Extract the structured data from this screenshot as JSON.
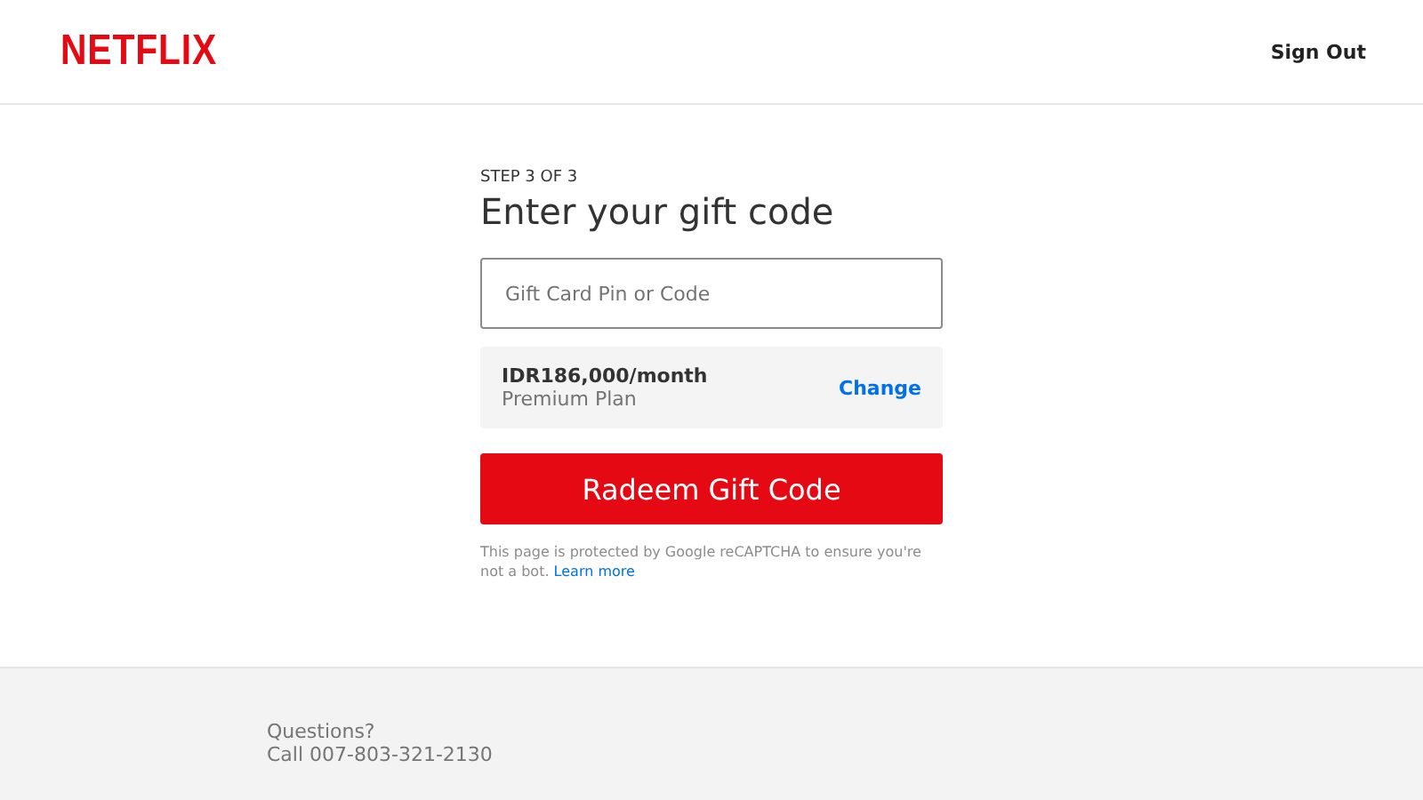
{
  "header": {
    "logo": "NETFLIX",
    "sign_out": "Sign Out"
  },
  "form": {
    "step": "STEP 3 OF 3",
    "title": "Enter your gift code",
    "code_field": {
      "placeholder": "Gift Card Pin or Code"
    },
    "plan": {
      "price": "IDR186,000/month",
      "name": "Premium Plan",
      "change": "Change"
    },
    "submit": "Radeem Gift Code",
    "notice": {
      "text": "This page is protected by Google reCAPTCHA to ensure you're not a bot.",
      "link": "Learn more"
    }
  },
  "footer": {
    "questions": "Questions?",
    "phone": "Call 007-803-321-2130"
  }
}
